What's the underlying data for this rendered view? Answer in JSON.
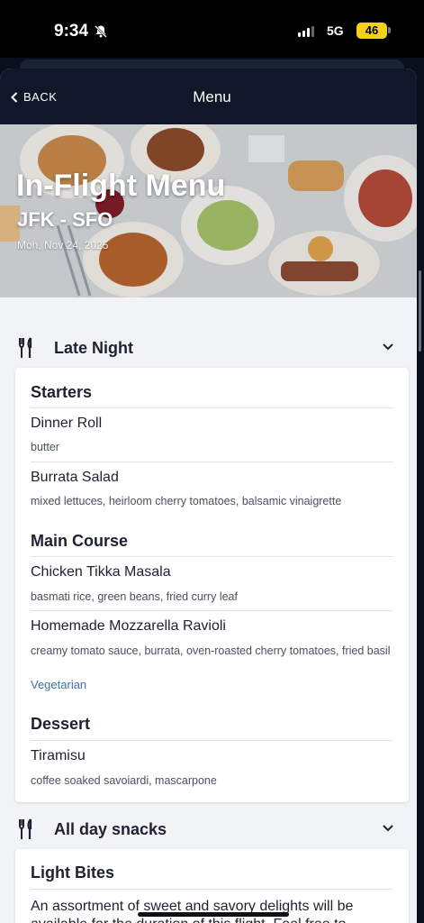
{
  "status": {
    "time": "9:34",
    "network": "5G",
    "battery": "46"
  },
  "nav": {
    "back_label": "BACK",
    "title": "Menu"
  },
  "hero": {
    "title": "In-Flight Menu",
    "route": "JFK - SFO",
    "date": "Mon, Nov 24, 2025"
  },
  "sections": [
    {
      "title": "Late Night",
      "icon": "fork-knife-icon",
      "categories": [
        {
          "title": "Starters",
          "items": [
            {
              "name": "Dinner Roll",
              "desc": "butter"
            },
            {
              "name": "Burrata Salad",
              "desc": "mixed lettuces, heirloom cherry tomatoes, balsamic vinaigrette"
            }
          ]
        },
        {
          "title": "Main Course",
          "items": [
            {
              "name": "Chicken Tikka Masala",
              "desc": "basmati rice, green beans, fried curry leaf"
            },
            {
              "name": "Homemade Mozzarella Ravioli",
              "desc": "creamy tomato sauce, burrata, oven-roasted cherry tomatoes, fried basil",
              "tag": "Vegetarian"
            }
          ]
        },
        {
          "title": "Dessert",
          "items": [
            {
              "name": "Tiramisu",
              "desc": "coffee soaked savoiardi, mascarpone"
            }
          ]
        }
      ]
    },
    {
      "title": "All day snacks",
      "icon": "fork-knife-icon",
      "categories": [
        {
          "title": "Light Bites",
          "text": "An assortment of sweet and savory delights will be available for the duration of this flight. Feel free to"
        }
      ]
    }
  ],
  "colors": {
    "navbar": "#0f1729",
    "background": "#f2f3f6",
    "tag": "#3b6fb0",
    "battery": "#f5d11f"
  }
}
